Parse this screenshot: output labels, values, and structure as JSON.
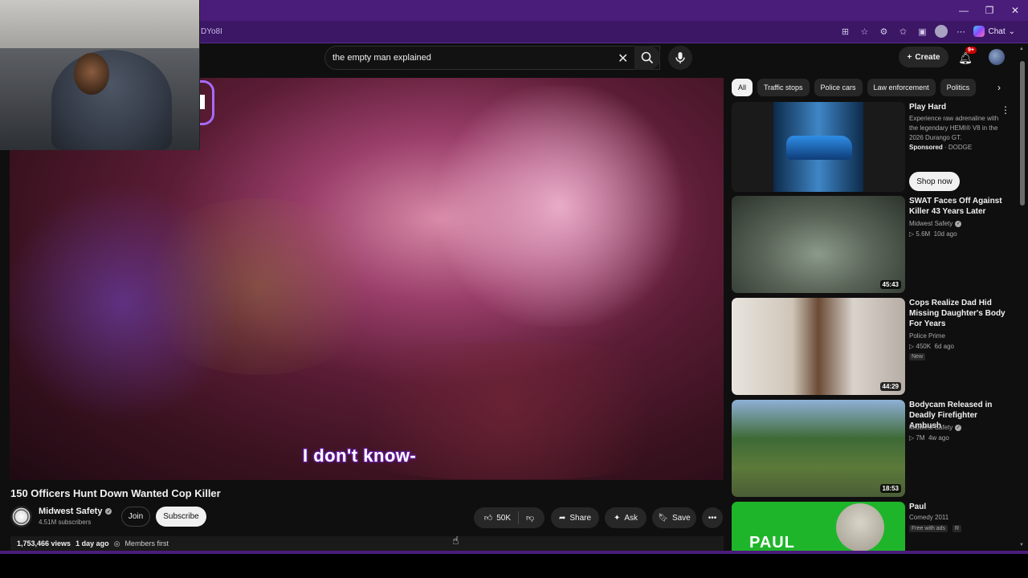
{
  "browser": {
    "url_fragment": "DYo8I",
    "chat_label": "Chat",
    "window_controls": [
      "—",
      "❐",
      "✕"
    ]
  },
  "header": {
    "search_query": "the empty man explained",
    "create_label": "Create",
    "notification_count": "9+"
  },
  "player": {
    "caption": "I don't know-"
  },
  "video": {
    "title": "150 Officers Hunt Down Wanted Cop Killer",
    "channel": "Midwest Safety",
    "subscribers": "4.51M subscribers",
    "join_label": "Join",
    "subscribe_label": "Subscribe",
    "likes": "50K",
    "share_label": "Share",
    "ask_label": "Ask",
    "save_label": "Save",
    "views": "1,753,466 views",
    "age": "1 day ago",
    "members_label": "Members first"
  },
  "chips": [
    "All",
    "Traffic stops",
    "Police cars",
    "Law enforcement",
    "Politics"
  ],
  "ad": {
    "title": "Play Hard",
    "description": "Experience raw adrenaline with the legendary HEMI® V8 in the 2026 Durango GT.",
    "sponsored_label": "Sponsored",
    "advertiser": "DODGE",
    "cta": "Shop now"
  },
  "recommendations": [
    {
      "title": "SWAT Faces Off Against Killer 43 Years Later",
      "channel": "Midwest Safety",
      "verified": true,
      "views": "5.6M",
      "age": "10d ago",
      "duration": "45:43"
    },
    {
      "title": "Cops Realize Dad Hid Missing Daughter's Body For Years",
      "channel": "Police Prime",
      "verified": false,
      "views": "450K",
      "age": "6d ago",
      "badge": "New",
      "duration": "44:29"
    },
    {
      "title": "Bodycam Released in Deadly Firefighter Ambush",
      "channel": "Midwest Safety",
      "verified": true,
      "views": "7M",
      "age": "4w ago",
      "duration": "18:53"
    },
    {
      "title": "Paul",
      "subtitle": "Comedy 2011",
      "free_label": "Free with ads",
      "rating": "R",
      "thumb_text": "PAUL"
    }
  ],
  "colors": {
    "browser_purple": "#4a1d7a",
    "yt_background": "#0f0f0f",
    "caption_outline": "#6b1fb0",
    "notification_red": "#cc0000"
  }
}
